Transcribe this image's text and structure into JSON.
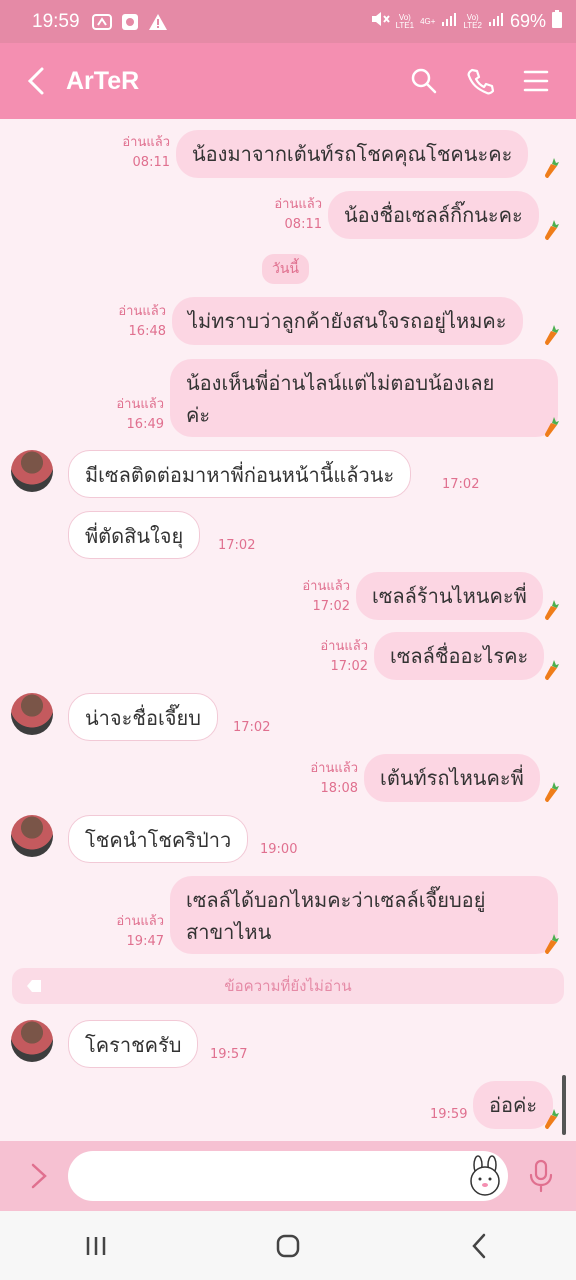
{
  "status": {
    "time": "19:59",
    "battery": "69%",
    "sim1": "LTE1",
    "sim2": "LTE2",
    "net": "4G+"
  },
  "header": {
    "title": "ArTeR"
  },
  "colors": {
    "accent": "#f48fb1",
    "bubble_me": "#fcd6e3",
    "meta": "#e0708f"
  },
  "messages": [
    {
      "side": "me",
      "text": "น้องมาจากเต้นท์รถโชคคุณโชคนะคะ",
      "read": "อ่านแล้ว",
      "time": "08:11"
    },
    {
      "side": "me",
      "text": "น้องชื่อเซลล์กิ๊กนะคะ",
      "read": "อ่านแล้ว",
      "time": "08:11"
    },
    {
      "side": "me",
      "text": "ไม่ทราบว่าลูกค้ายังสนใจรถอยู่ไหมคะ",
      "read": "อ่านแล้ว",
      "time": "16:48"
    },
    {
      "side": "me",
      "text_line1": "น้องเห็นพี่อ่านไลน์แต่ไม่ตอบน้องเลย",
      "text_line2": "ค่ะ",
      "read": "อ่านแล้ว",
      "time": "16:49"
    },
    {
      "side": "them",
      "text": "มีเซลติดต่อมาหาพี่ก่อนหน้านี้แล้วนะ",
      "time": "17:02"
    },
    {
      "side": "them",
      "text": "พี่ตัดสินใจยุ",
      "time": "17:02"
    },
    {
      "side": "me",
      "text": "เซลล์ร้านไหนคะพี่",
      "read": "อ่านแล้ว",
      "time": "17:02"
    },
    {
      "side": "me",
      "text": "เซลล์ชื่ออะไรคะ",
      "read": "อ่านแล้ว",
      "time": "17:02"
    },
    {
      "side": "them",
      "text": "น่าจะชื่อเจี๊ยบ",
      "time": "17:02"
    },
    {
      "side": "me",
      "text": "เต้นท์รถไหนคะพี่",
      "read": "อ่านแล้ว",
      "time": "18:08"
    },
    {
      "side": "them",
      "text": "โชคนำโชคริป่าว",
      "time": "19:00"
    },
    {
      "side": "me",
      "text_line1": "เซลล์ได้บอกไหมคะว่าเซลล์เจี๊ยบอยู่",
      "text_line2": "สาขาไหน",
      "read": "อ่านแล้ว",
      "time": "19:47"
    },
    {
      "side": "them",
      "text": "โคราชครับ",
      "time": "19:57"
    },
    {
      "side": "me",
      "text": "อ่อค่ะ",
      "time": "19:59"
    }
  ],
  "date_pill": "วันนี้",
  "unread_divider": "ข้อความที่ยังไม่อ่าน"
}
